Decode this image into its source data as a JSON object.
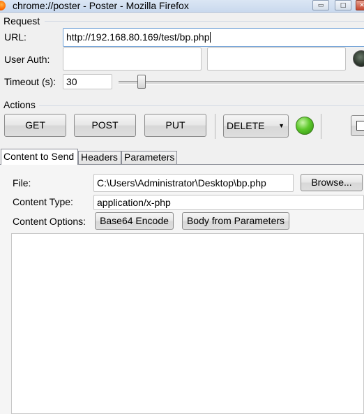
{
  "window": {
    "title": "chrome://poster - Poster - Mozilla Firefox",
    "icon": "firefox-icon",
    "min_symbol": "▭",
    "max_symbol": "□",
    "close_symbol": "✕"
  },
  "request": {
    "section_label": "Request",
    "url_label": "URL:",
    "url_value": "http://192.168.80.169/test/bp.php",
    "user_auth_label": "User Auth:",
    "user_value": "",
    "password_value": "",
    "timeout_label": "Timeout (s):",
    "timeout_value": "30"
  },
  "actions": {
    "section_label": "Actions",
    "get_label": "GET",
    "post_label": "POST",
    "put_label": "PUT",
    "method_select_value": "DELETE",
    "status_color": "#5ec92c"
  },
  "tabs": [
    {
      "label": "Content to Send",
      "active": true
    },
    {
      "label": "Headers",
      "active": false
    },
    {
      "label": "Parameters",
      "active": false
    }
  ],
  "content": {
    "file_label": "File:",
    "file_value": "C:\\Users\\Administrator\\Desktop\\bp.php",
    "browse_label": "Browse...",
    "content_type_label": "Content Type:",
    "content_type_value": "application/x-php",
    "content_options_label": "Content Options:",
    "base64_label": "Base64 Encode",
    "body_from_params_label": "Body from Parameters",
    "body_value": ""
  }
}
